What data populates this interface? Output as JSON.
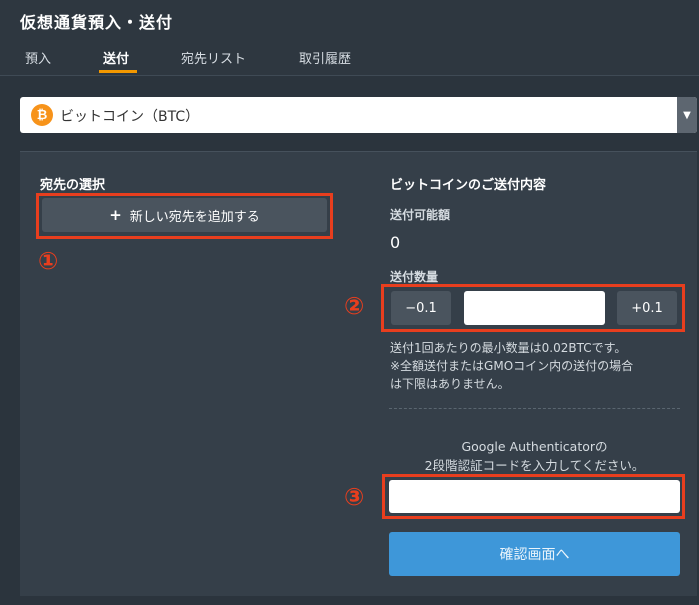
{
  "header": {
    "title": "仮想通貨預入・送付",
    "tabs": [
      {
        "label": "預入"
      },
      {
        "label": "送付"
      },
      {
        "label": "宛先リスト"
      },
      {
        "label": "取引履歴"
      }
    ],
    "active_tab": "送付",
    "accent_color": "#f39800"
  },
  "coin_select": {
    "icon": "bitcoin-icon",
    "icon_glyph": "₿",
    "selected": "ビットコイン（BTC）"
  },
  "destination": {
    "heading": "宛先の選択",
    "add_button_icon": "plus-icon",
    "add_button_icon_glyph": "+",
    "add_button_label": "新しい宛先を追加する"
  },
  "send": {
    "heading": "ビットコインのご送付内容",
    "available_label": "送付可能額",
    "available_value": "0",
    "quantity_label": "送付数量",
    "minus_label": "−0.1",
    "plus_label": "+0.1",
    "quantity_value": "",
    "note_lines": [
      "送付1回あたりの最小数量は0.02BTCです。",
      "※全額送付またはGMOコイン内の送付の場合",
      "は下限はありません。"
    ],
    "auth_lines": [
      "Google Authenticatorの",
      "2段階認証コードを入力してください。"
    ],
    "auth_value": "",
    "confirm_label": "確認画面へ",
    "confirm_color": "#3e97d9"
  },
  "annotations": {
    "marker_1": "①",
    "marker_2": "②",
    "marker_3": "③",
    "color": "#e83e1e"
  }
}
